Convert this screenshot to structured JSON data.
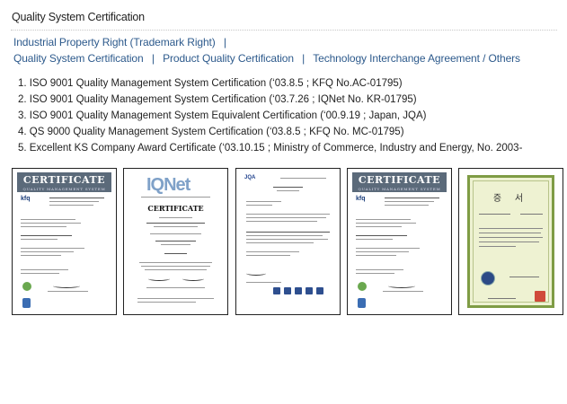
{
  "page": {
    "title": "Quality System Certification"
  },
  "nav": {
    "line1": [
      {
        "label": "Industrial Property Right (Trademark Right)"
      }
    ],
    "line2": [
      {
        "label": "Quality System Certification"
      },
      {
        "label": "Product Quality Certification"
      },
      {
        "label": "Technology Interchange Agreement / Others"
      }
    ],
    "separator": "|"
  },
  "certifications": [
    "1. ISO 9001 Quality Management System Certification (‘03.8.5 ; KFQ No.AC-01795)",
    "2. ISO 9001 Quality Management System Certification (‘03.7.26 ; IQNet No. KR-01795)",
    "3. ISO 9001 Quality Management System Equivalent Certification (‘00.9.19 ; Japan, JQA)",
    "4. QS 9000 Quality Management System Certification (‘03.8.5 ; KFQ No. MC-01795)",
    "5. Excellent KS Company Award Certificate (‘03.10.15 ; Ministry of Commerce, Industry and Energy, No. 2003-"
  ],
  "thumbnails": {
    "kfq_banner": "CERTIFICATE",
    "kfq_banner_sub": "QUALITY MANAGEMENT SYSTEM",
    "kfq_logo": "kfq",
    "iqnet_logo": "IQNet",
    "iqnet_cert": "CERTIFICATE",
    "jqa_logo": "JQA",
    "korean_title": "증 서"
  },
  "colors": {
    "link": "#2d5a8c",
    "banner": "#5b6a7a",
    "korean_border": "#7f9c45"
  }
}
